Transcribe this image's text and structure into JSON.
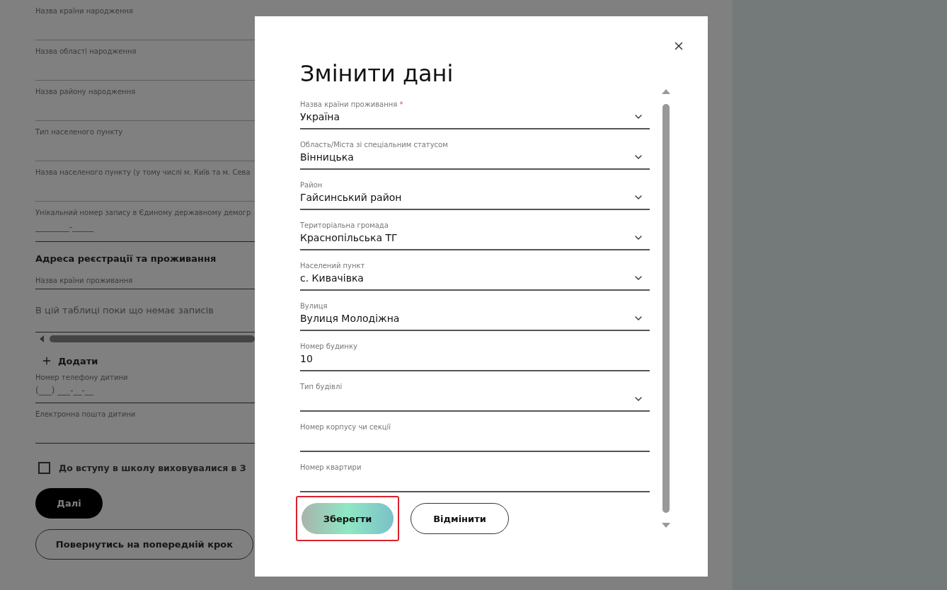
{
  "background_form": {
    "fields": [
      {
        "label": "Назва країни народження"
      },
      {
        "label": "Назва області народження"
      },
      {
        "label": "Назва району народження"
      },
      {
        "label": "Тип населеного пункту"
      },
      {
        "label": "Назва населеного пункту (у тому числі м. Київ та м. Сева"
      },
      {
        "label": "Унікальний номер запису в Єдиному державному демогр",
        "placeholder": "________-_____"
      }
    ],
    "section_title": "Адреса реєстрації та проживання",
    "residence_field": {
      "label": "Назва країни проживання"
    },
    "table": {
      "empty_text": "В цій таблиці поки що немає записів"
    },
    "add_button": {
      "label": "Додати"
    },
    "phone_field": {
      "label": "Номер телефону дитини",
      "placeholder": "(___) ___-__-__"
    },
    "email_field": {
      "label": "Електронна пошта дитини"
    },
    "checkbox": {
      "label": "До вступу в школу виховувалися в З",
      "checked": false
    },
    "next_button": {
      "label": "Далі"
    },
    "back_button": {
      "label": "Повернутись на попередній крок"
    }
  },
  "dialog": {
    "title": "Змінити дані",
    "fields": [
      {
        "kind": "select",
        "label": "Назва країни проживання",
        "required_mark": "*",
        "value": "Україна"
      },
      {
        "kind": "select",
        "label": "Область/Міста зі спеціальним статусом",
        "value": "Вінницька"
      },
      {
        "kind": "select",
        "label": "Район",
        "value": "Гайсинський район"
      },
      {
        "kind": "select",
        "label": "Територіальна громада",
        "value": "Краснопільська  ТГ"
      },
      {
        "kind": "select",
        "label": "Населений пункт",
        "value": "с. Кивачівка"
      },
      {
        "kind": "select",
        "label": "Вулиця",
        "value": "Вулиця Молодіжна"
      },
      {
        "kind": "text",
        "label": "Номер будинку",
        "value": "10"
      },
      {
        "kind": "select",
        "label": "Тип будівлі"
      },
      {
        "kind": "text",
        "label": "Номер корпусу чи секції"
      },
      {
        "kind": "text",
        "label": "Номер квартири"
      }
    ],
    "save_button": {
      "label": "Зберегти",
      "focused": true
    },
    "cancel_button": {
      "label": "Відмінити"
    }
  }
}
